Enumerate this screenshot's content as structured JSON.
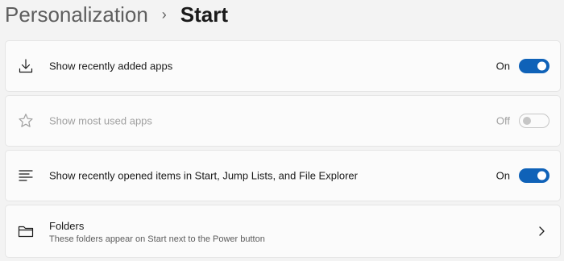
{
  "breadcrumb": {
    "parent": "Personalization",
    "separator": "›",
    "current": "Start"
  },
  "rows": [
    {
      "label": "Show recently added apps",
      "icon": "download-icon",
      "state": "On",
      "enabled": true
    },
    {
      "label": "Show most used apps",
      "icon": "star-icon",
      "state": "Off",
      "enabled": false
    },
    {
      "label": "Show recently opened items in Start, Jump Lists, and File Explorer",
      "icon": "list-icon",
      "state": "On",
      "enabled": true
    }
  ],
  "folders": {
    "title": "Folders",
    "description": "These folders appear on Start next to the Power button",
    "icon": "folder-icon"
  },
  "colors": {
    "accent": "#0f62b8",
    "background": "#f3f3f3",
    "card": "#fbfbfb"
  }
}
